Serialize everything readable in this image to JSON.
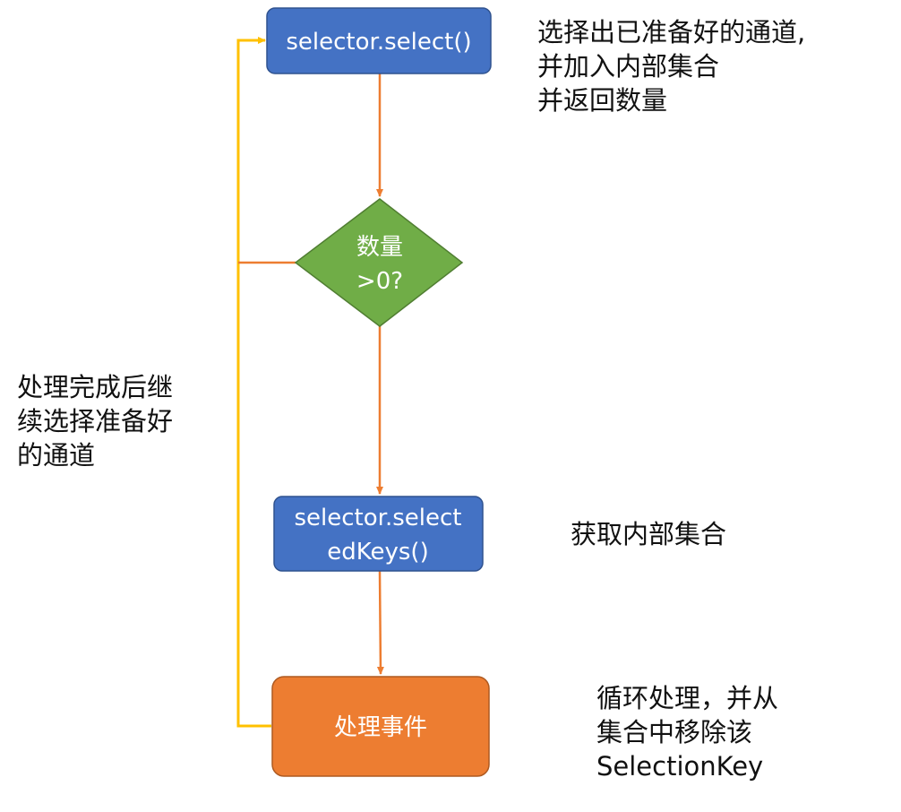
{
  "nodes": {
    "select": {
      "label": "selector.select()"
    },
    "decision": {
      "line1": "数量",
      "line2": ">0?"
    },
    "selected_keys": {
      "line1": "selector.select",
      "line2": "edKeys()"
    },
    "process": {
      "label": "处理事件"
    }
  },
  "annotations": {
    "select_note": [
      "选择出已准备好的通道,",
      "并加入内部集合",
      "并返回数量"
    ],
    "selected_keys_note": [
      "获取内部集合"
    ],
    "process_note": [
      "循环处理，并从",
      "集合中移除该",
      "SelectionKey"
    ],
    "loop_note": [
      "处理完成后继",
      "续选择准备好",
      "的通道"
    ]
  },
  "colors": {
    "blue_box": "#4472c4",
    "blue_border": "#2f528f",
    "green_diamond": "#70ad47",
    "green_border": "#507e32",
    "orange_box": "#ed7d31",
    "orange_border": "#ae5a21",
    "flow_arrow": "#ed7d31",
    "loop_line": "#ffc000"
  }
}
